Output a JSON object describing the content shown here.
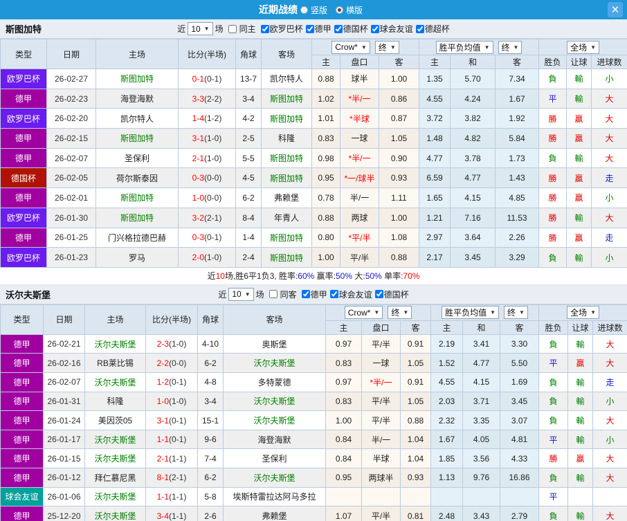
{
  "titlebar": {
    "title": "近期战绩",
    "vertical_label": "竖版",
    "horizontal_label": "横版",
    "close": "✕"
  },
  "columns": {
    "type": "类型",
    "date": "日期",
    "home": "主场",
    "score": "比分(半场)",
    "corners": "角球",
    "away": "客场",
    "odds_home": "主",
    "handicap": "盘口",
    "odds_away": "客",
    "avg_home": "主",
    "avg_draw": "和",
    "avg_away": "客",
    "result": "胜负",
    "handicap_result": "让球",
    "goals": "进球数"
  },
  "dropdowns": {
    "bookmaker": "Crow*",
    "final_a": "终",
    "average": "胜平负均值",
    "final_b": "终",
    "scope": "全场"
  },
  "filter_text": {
    "near": "近",
    "games": "场"
  },
  "type_colors": {
    "欧罗巴杯": "#6b1cee",
    "德甲": "#a100a1",
    "德国杯": "#b01305",
    "球会友谊": "#00a09b"
  },
  "result_colors": {
    "r": "#e00000",
    "g": "#008000",
    "b": "#1414d2"
  },
  "sections": [
    {
      "team": "斯图加特",
      "filter": {
        "count": "10",
        "same": "同主",
        "competitions": [
          "欧罗巴杯",
          "德甲",
          "德国杯",
          "球会友谊",
          "德超杯"
        ]
      },
      "rows": [
        {
          "type": "欧罗巴杯",
          "date": "26-02-27",
          "home": "斯图加特",
          "home_focus": true,
          "score": "0-1",
          "half": "(0-1)",
          "corners": "13-7",
          "away": "凯尔特人",
          "away_focus": false,
          "o1": "0.88",
          "hcap": "球半",
          "star": false,
          "o2": "1.00",
          "m1": "1.35",
          "m2": "5.70",
          "m3": "7.34",
          "res": "負",
          "res_c": "g",
          "let": "輸",
          "let_c": "g",
          "goal": "小",
          "goal_c": "g"
        },
        {
          "type": "德甲",
          "date": "26-02-23",
          "home": "海登海默",
          "home_focus": false,
          "score": "3-3",
          "half": "(2-2)",
          "corners": "3-4",
          "away": "斯图加特",
          "away_focus": true,
          "o1": "1.02",
          "hcap": "半/一",
          "star": true,
          "o2": "0.86",
          "m1": "4.55",
          "m2": "4.24",
          "m3": "1.67",
          "res": "平",
          "res_c": "b",
          "let": "輸",
          "let_c": "g",
          "goal": "大",
          "goal_c": "r"
        },
        {
          "type": "欧罗巴杯",
          "date": "26-02-20",
          "home": "凯尔特人",
          "home_focus": false,
          "score": "1-4",
          "half": "(1-2)",
          "corners": "4-2",
          "away": "斯图加特",
          "away_focus": true,
          "o1": "1.01",
          "hcap": "半球",
          "star": true,
          "o2": "0.87",
          "m1": "3.72",
          "m2": "3.82",
          "m3": "1.92",
          "res": "勝",
          "res_c": "r",
          "let": "贏",
          "let_c": "r",
          "goal": "大",
          "goal_c": "r"
        },
        {
          "type": "德甲",
          "date": "26-02-15",
          "home": "斯图加特",
          "home_focus": true,
          "score": "3-1",
          "half": "(1-0)",
          "corners": "2-5",
          "away": "科隆",
          "away_focus": false,
          "o1": "0.83",
          "hcap": "一球",
          "star": false,
          "o2": "1.05",
          "m1": "1.48",
          "m2": "4.82",
          "m3": "5.84",
          "res": "勝",
          "res_c": "r",
          "let": "贏",
          "let_c": "r",
          "goal": "大",
          "goal_c": "r"
        },
        {
          "type": "德甲",
          "date": "26-02-07",
          "home": "圣保利",
          "home_focus": false,
          "score": "2-1",
          "half": "(1-0)",
          "corners": "5-5",
          "away": "斯图加特",
          "away_focus": true,
          "o1": "0.98",
          "hcap": "半/一",
          "star": true,
          "o2": "0.90",
          "m1": "4.77",
          "m2": "3.78",
          "m3": "1.73",
          "res": "負",
          "res_c": "g",
          "let": "輸",
          "let_c": "g",
          "goal": "大",
          "goal_c": "r"
        },
        {
          "type": "德国杯",
          "date": "26-02-05",
          "home": "荷尔斯泰因",
          "home_focus": false,
          "score": "0-3",
          "half": "(0-0)",
          "corners": "4-5",
          "away": "斯图加特",
          "away_focus": true,
          "o1": "0.95",
          "hcap": "一/球半",
          "star": true,
          "o2": "0.93",
          "m1": "6.59",
          "m2": "4.77",
          "m3": "1.43",
          "res": "勝",
          "res_c": "r",
          "let": "贏",
          "let_c": "r",
          "goal": "走",
          "goal_c": "b"
        },
        {
          "type": "德甲",
          "date": "26-02-01",
          "home": "斯图加特",
          "home_focus": true,
          "score": "1-0",
          "half": "(0-0)",
          "corners": "6-2",
          "away": "弗赖堡",
          "away_focus": false,
          "o1": "0.78",
          "hcap": "半/一",
          "star": false,
          "o2": "1.11",
          "m1": "1.65",
          "m2": "4.15",
          "m3": "4.85",
          "res": "勝",
          "res_c": "r",
          "let": "贏",
          "let_c": "r",
          "goal": "小",
          "goal_c": "g"
        },
        {
          "type": "欧罗巴杯",
          "date": "26-01-30",
          "home": "斯图加特",
          "home_focus": true,
          "score": "3-2",
          "half": "(2-1)",
          "corners": "8-4",
          "away": "年青人",
          "away_focus": false,
          "o1": "0.88",
          "hcap": "两球",
          "star": false,
          "o2": "1.00",
          "m1": "1.21",
          "m2": "7.16",
          "m3": "11.53",
          "res": "勝",
          "res_c": "r",
          "let": "輸",
          "let_c": "g",
          "goal": "大",
          "goal_c": "r"
        },
        {
          "type": "德甲",
          "date": "26-01-25",
          "home": "门兴格拉德巴赫",
          "home_focus": false,
          "score": "0-3",
          "half": "(0-1)",
          "corners": "1-4",
          "away": "斯图加特",
          "away_focus": true,
          "o1": "0.80",
          "hcap": "平/半",
          "star": true,
          "o2": "1.08",
          "m1": "2.97",
          "m2": "3.64",
          "m3": "2.26",
          "res": "勝",
          "res_c": "r",
          "let": "贏",
          "let_c": "r",
          "goal": "走",
          "goal_c": "b"
        },
        {
          "type": "欧罗巴杯",
          "date": "26-01-23",
          "home": "罗马",
          "home_focus": false,
          "score": "2-0",
          "half": "(1-0)",
          "corners": "2-4",
          "away": "斯图加特",
          "away_focus": true,
          "o1": "1.00",
          "hcap": "平/半",
          "star": false,
          "o2": "0.88",
          "m1": "2.17",
          "m2": "3.45",
          "m3": "3.29",
          "res": "負",
          "res_c": "g",
          "let": "輸",
          "let_c": "g",
          "goal": "小",
          "goal_c": "g"
        }
      ],
      "summary": [
        {
          "t": "近",
          "c": "#222222"
        },
        {
          "t": "10",
          "c": "#ff0000"
        },
        {
          "t": "场,胜6平1负3, 胜率:",
          "c": "#222222"
        },
        {
          "t": "60%",
          "c": "#1414d2"
        },
        {
          "t": " 赢率:",
          "c": "#222222"
        },
        {
          "t": "50%",
          "c": "#1414d2"
        },
        {
          "t": " 大:",
          "c": "#222222"
        },
        {
          "t": "50%",
          "c": "#1414d2"
        },
        {
          "t": " 单率:",
          "c": "#222222"
        },
        {
          "t": "70%",
          "c": "#ff0000"
        }
      ]
    },
    {
      "team": "沃尔夫斯堡",
      "filter": {
        "count": "10",
        "same": "同客",
        "competitions": [
          "德甲",
          "球会友谊",
          "德国杯"
        ]
      },
      "rows": [
        {
          "type": "德甲",
          "date": "26-02-21",
          "home": "沃尔夫斯堡",
          "home_focus": true,
          "score": "2-3",
          "half": "(1-0)",
          "corners": "4-10",
          "away": "奥斯堡",
          "away_focus": false,
          "o1": "0.97",
          "hcap": "平/半",
          "star": false,
          "o2": "0.91",
          "m1": "2.19",
          "m2": "3.41",
          "m3": "3.30",
          "res": "負",
          "res_c": "g",
          "let": "輸",
          "let_c": "g",
          "goal": "大",
          "goal_c": "r"
        },
        {
          "type": "德甲",
          "date": "26-02-16",
          "home": "RB莱比锡",
          "home_focus": false,
          "score": "2-2",
          "half": "(0-0)",
          "corners": "6-2",
          "away": "沃尔夫斯堡",
          "away_focus": true,
          "o1": "0.83",
          "hcap": "一球",
          "star": false,
          "o2": "1.05",
          "m1": "1.52",
          "m2": "4.77",
          "m3": "5.50",
          "res": "平",
          "res_c": "b",
          "let": "贏",
          "let_c": "r",
          "goal": "大",
          "goal_c": "r"
        },
        {
          "type": "德甲",
          "date": "26-02-07",
          "home": "沃尔夫斯堡",
          "home_focus": true,
          "score": "1-2",
          "half": "(0-1)",
          "corners": "4-8",
          "away": "多特蒙德",
          "away_focus": false,
          "o1": "0.97",
          "hcap": "半/一",
          "star": true,
          "o2": "0.91",
          "m1": "4.55",
          "m2": "4.15",
          "m3": "1.69",
          "res": "負",
          "res_c": "g",
          "let": "輸",
          "let_c": "g",
          "goal": "走",
          "goal_c": "b"
        },
        {
          "type": "德甲",
          "date": "26-01-31",
          "home": "科隆",
          "home_focus": false,
          "score": "1-0",
          "half": "(1-0)",
          "corners": "3-4",
          "away": "沃尔夫斯堡",
          "away_focus": true,
          "o1": "0.83",
          "hcap": "平/半",
          "star": false,
          "o2": "1.05",
          "m1": "2.03",
          "m2": "3.71",
          "m3": "3.45",
          "res": "負",
          "res_c": "g",
          "let": "輸",
          "let_c": "g",
          "goal": "小",
          "goal_c": "g"
        },
        {
          "type": "德甲",
          "date": "26-01-24",
          "home": "美因茨05",
          "home_focus": false,
          "score": "3-1",
          "half": "(0-1)",
          "corners": "15-1",
          "away": "沃尔夫斯堡",
          "away_focus": true,
          "o1": "1.00",
          "hcap": "平/半",
          "star": false,
          "o2": "0.88",
          "m1": "2.32",
          "m2": "3.35",
          "m3": "3.07",
          "res": "負",
          "res_c": "g",
          "let": "輸",
          "let_c": "g",
          "goal": "大",
          "goal_c": "r"
        },
        {
          "type": "德甲",
          "date": "26-01-17",
          "home": "沃尔夫斯堡",
          "home_focus": true,
          "score": "1-1",
          "half": "(0-1)",
          "corners": "9-6",
          "away": "海登海默",
          "away_focus": false,
          "o1": "0.84",
          "hcap": "半/一",
          "star": false,
          "o2": "1.04",
          "m1": "1.67",
          "m2": "4.05",
          "m3": "4.81",
          "res": "平",
          "res_c": "b",
          "let": "輸",
          "let_c": "g",
          "goal": "小",
          "goal_c": "g"
        },
        {
          "type": "德甲",
          "date": "26-01-15",
          "home": "沃尔夫斯堡",
          "home_focus": true,
          "score": "2-1",
          "half": "(1-1)",
          "corners": "7-4",
          "away": "圣保利",
          "away_focus": false,
          "o1": "0.84",
          "hcap": "半球",
          "star": false,
          "o2": "1.04",
          "m1": "1.85",
          "m2": "3.56",
          "m3": "4.33",
          "res": "勝",
          "res_c": "r",
          "let": "贏",
          "let_c": "r",
          "goal": "大",
          "goal_c": "r"
        },
        {
          "type": "德甲",
          "date": "26-01-12",
          "home": "拜仁慕尼黑",
          "home_focus": false,
          "score": "8-1",
          "half": "(2-1)",
          "corners": "6-2",
          "away": "沃尔夫斯堡",
          "away_focus": true,
          "o1": "0.95",
          "hcap": "两球半",
          "star": false,
          "o2": "0.93",
          "m1": "1.13",
          "m2": "9.76",
          "m3": "16.86",
          "res": "負",
          "res_c": "g",
          "let": "輸",
          "let_c": "g",
          "goal": "大",
          "goal_c": "r"
        },
        {
          "type": "球会友谊",
          "date": "26-01-06",
          "home": "沃尔夫斯堡",
          "home_focus": true,
          "score": "1-1",
          "half": "(1-1)",
          "corners": "5-8",
          "away": "埃斯特雷拉达阿马多拉",
          "away_focus": false,
          "o1": "",
          "hcap": "",
          "star": false,
          "o2": "",
          "m1": "",
          "m2": "",
          "m3": "",
          "res": "平",
          "res_c": "b",
          "let": "",
          "let_c": null,
          "goal": "",
          "goal_c": null
        },
        {
          "type": "德甲",
          "date": "25-12-20",
          "home": "沃尔夫斯堡",
          "home_focus": true,
          "score": "3-4",
          "half": "(1-1)",
          "corners": "2-6",
          "away": "弗赖堡",
          "away_focus": false,
          "o1": "1.07",
          "hcap": "平/半",
          "star": false,
          "o2": "0.81",
          "m1": "2.48",
          "m2": "3.43",
          "m3": "2.79",
          "res": "負",
          "res_c": "g",
          "let": "輸",
          "let_c": "g",
          "goal": "大",
          "goal_c": "r"
        }
      ],
      "summary": null
    }
  ]
}
